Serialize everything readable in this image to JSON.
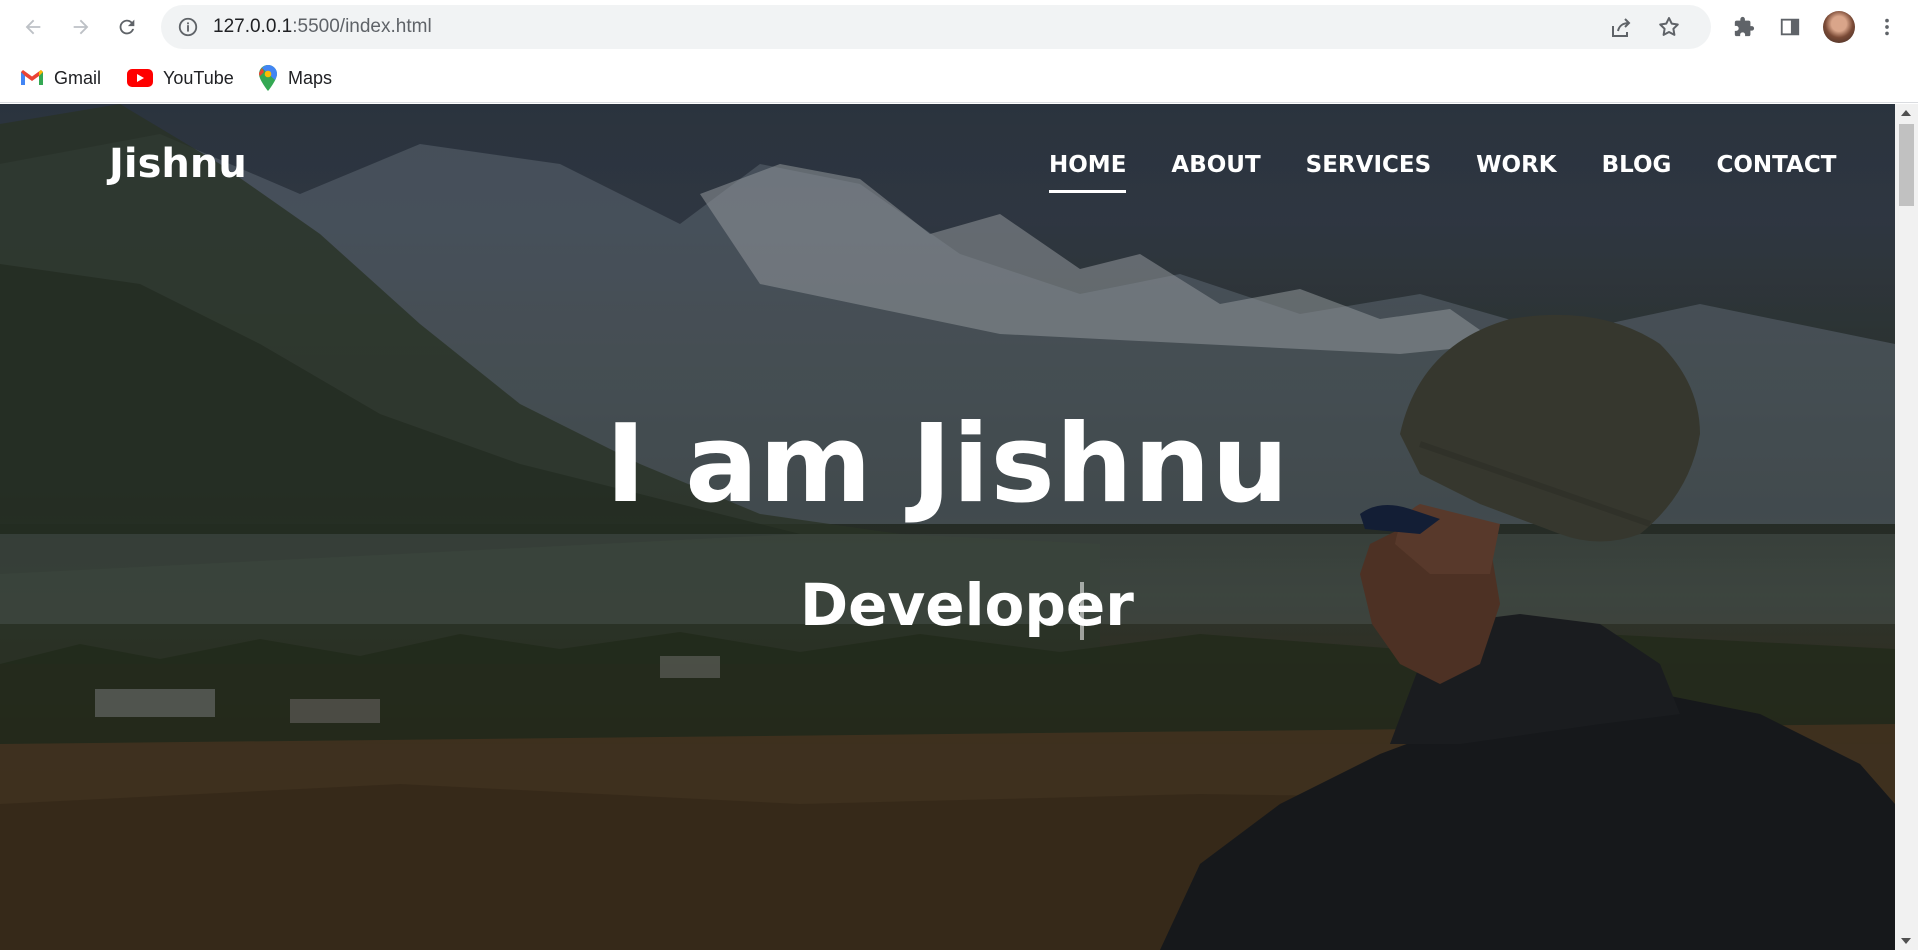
{
  "browser": {
    "url_host": "127.0.0.1",
    "url_rest": ":5500/index.html",
    "bookmarks": [
      {
        "label": "Gmail",
        "icon": "gmail-icon"
      },
      {
        "label": "YouTube",
        "icon": "youtube-icon"
      },
      {
        "label": "Maps",
        "icon": "maps-icon"
      }
    ]
  },
  "site": {
    "logo": "Jishnu",
    "nav": [
      {
        "label": "HOME",
        "active": true
      },
      {
        "label": "ABOUT"
      },
      {
        "label": "SERVICES"
      },
      {
        "label": "WORK"
      },
      {
        "label": "BLOG"
      },
      {
        "label": "CONTACT"
      }
    ],
    "hero_title": "I am Jishnu",
    "hero_subtitle": "Developer"
  },
  "colors": {
    "nav_text": "#ffffff",
    "youtube_red": "#ff0000",
    "omnibox_bg": "#f1f3f4"
  }
}
